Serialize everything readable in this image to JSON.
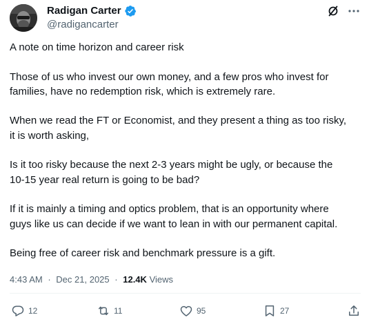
{
  "user": {
    "display_name": "Radigan Carter",
    "handle": "@radigancarter"
  },
  "icons": {
    "verified": "verified-badge-icon",
    "grok": "grok-icon",
    "more": "more-icon",
    "reply": "reply-icon",
    "repost": "repost-icon",
    "like": "like-icon",
    "bookmark": "bookmark-icon",
    "share": "share-icon"
  },
  "colors": {
    "verified": "#1d9bf0",
    "text": "#0f1419",
    "muted": "#536471"
  },
  "post": {
    "paragraphs": [
      "A note on time horizon and career risk",
      "Those of us who invest our own money, and a few pros who invest for\nfamilies, have no redemption risk, which is extremely rare.",
      "When we read the FT or Economist, and they present a thing as too risky,\nit is worth asking,",
      "Is it too risky because the next 2-3 years might be ugly, or because the\n10-15 year real return is going to be bad?",
      "If it is mainly a timing and optics problem, that is an opportunity where\nguys like us can decide if we want to lean in with our permanent capital.",
      "Being free of career risk and benchmark pressure is a gift."
    ]
  },
  "meta": {
    "time": "4:43 AM",
    "date": "Dec 21, 2025",
    "separator": "·",
    "views_count": "12.4K",
    "views_label": "Views"
  },
  "actions": {
    "reply_count": "12",
    "repost_count": "11",
    "like_count": "95",
    "bookmark_count": "27"
  }
}
